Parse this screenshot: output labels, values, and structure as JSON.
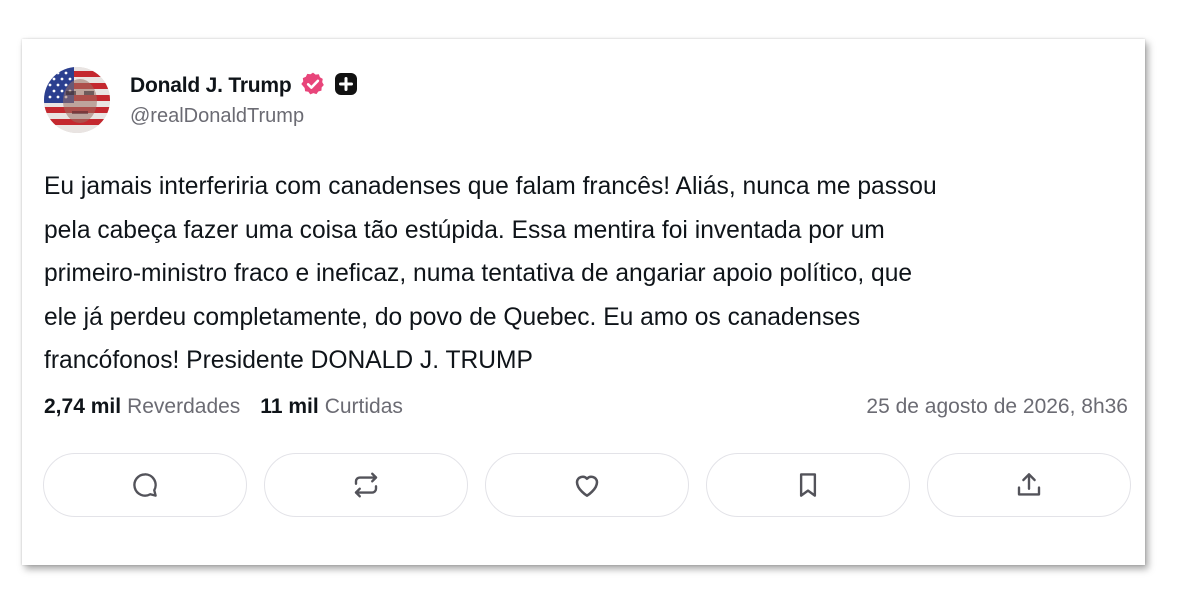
{
  "post": {
    "author": {
      "display_name": "Donald J. Trump",
      "handle": "@realDonaldTrump",
      "badges": [
        "verified-badge-icon",
        "plus-badge-icon"
      ]
    },
    "text_lines": [
      "Eu jamais interferiria com canadenses que falam francês! Aliás, nunca me passou",
      "pela cabeça fazer uma coisa tão estúpida. Essa mentira foi inventada por um",
      "primeiro-ministro fraco e ineficaz, numa tentativa de angariar apoio político, que",
      "ele já perdeu completamente, do povo de Quebec. Eu amo os canadenses",
      "francófonos! Presidente DONALD J. TRUMP"
    ],
    "stats": {
      "reposts_count": "2,74 mil",
      "reposts_label": "Reverdades",
      "likes_count": "11 mil",
      "likes_label": "Curtidas"
    },
    "timestamp": "25 de agosto de 2026, 8h36"
  },
  "actions": [
    {
      "name": "reply",
      "icon": "comment-icon"
    },
    {
      "name": "repost",
      "icon": "repost-icon"
    },
    {
      "name": "like",
      "icon": "heart-icon"
    },
    {
      "name": "bookmark",
      "icon": "bookmark-icon"
    },
    {
      "name": "share",
      "icon": "share-icon"
    }
  ],
  "colors": {
    "text_primary": "#0f1419",
    "text_secondary": "#6b6b73",
    "verified_badge": "#e8457a",
    "border": "#e3e3e8"
  }
}
